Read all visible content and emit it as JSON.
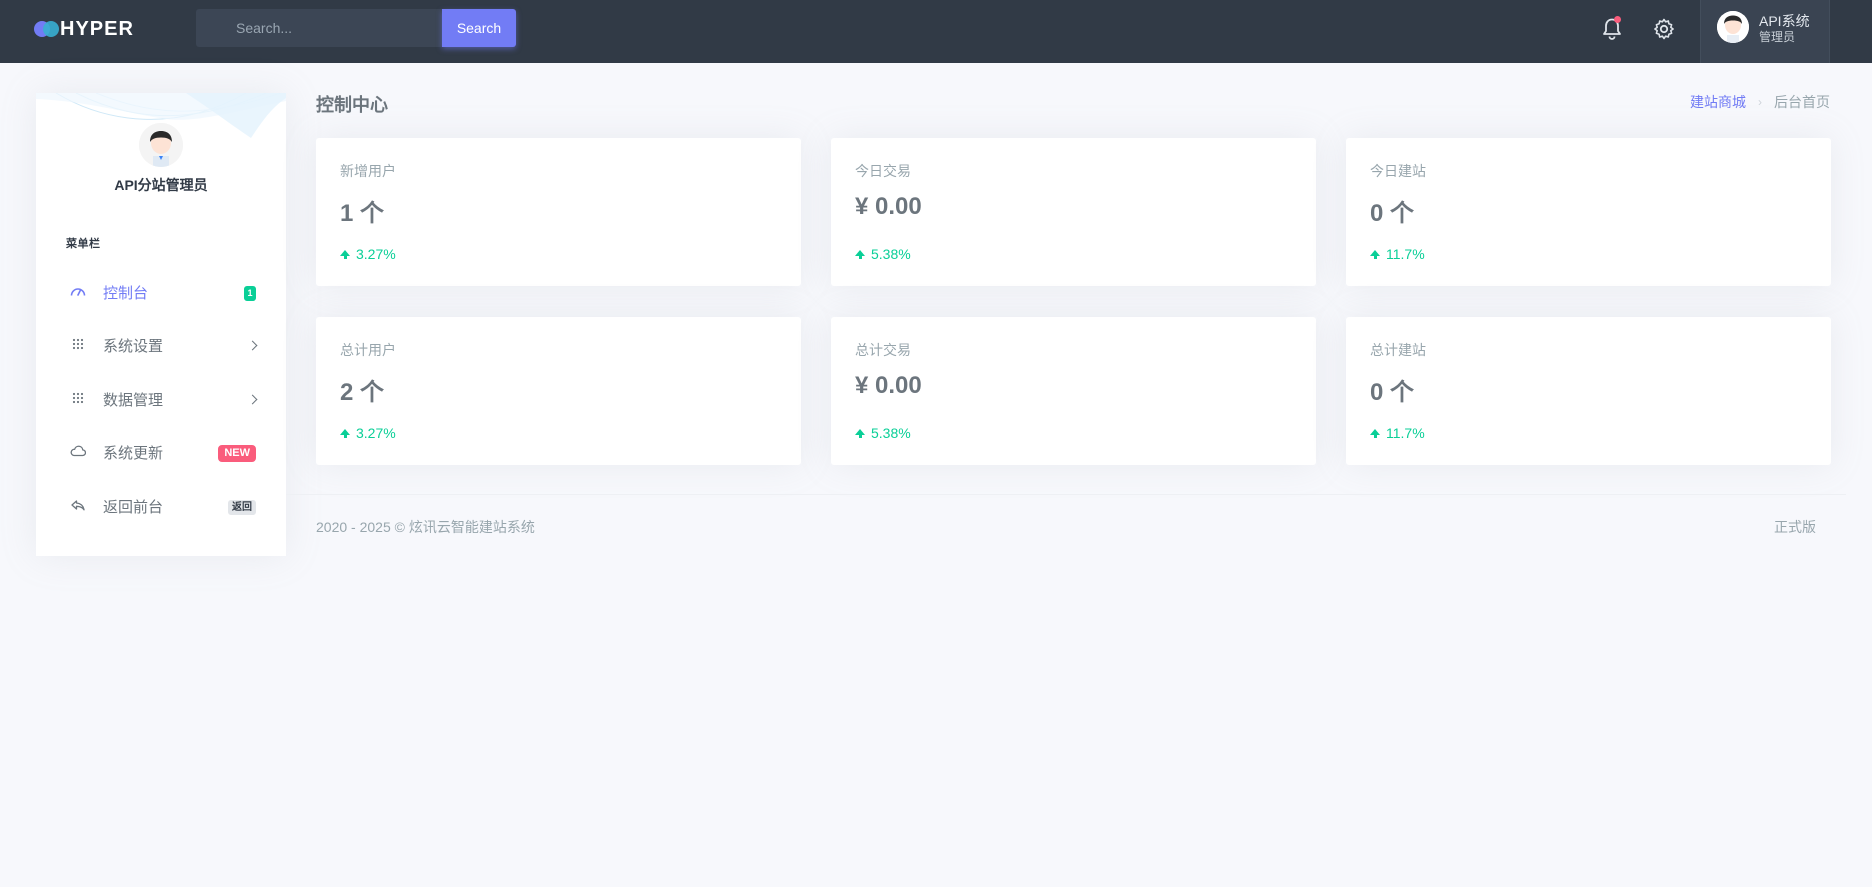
{
  "brand": {
    "name": "HYPER"
  },
  "topbar": {
    "search_placeholder": "Search...",
    "search_button": "Search",
    "user_name": "API系统",
    "user_role": "管理员"
  },
  "sidebar": {
    "profile_name": "API分站管理员",
    "menu_title": "菜单栏",
    "items": [
      {
        "label": "控制台",
        "icon": "dashboard-icon",
        "badge": "1",
        "active": true
      },
      {
        "label": "系统设置",
        "icon": "grid-icon"
      },
      {
        "label": "数据管理",
        "icon": "grid-icon"
      },
      {
        "label": "系统更新",
        "icon": "cloud-icon",
        "badge": "NEW"
      },
      {
        "label": "返回前台",
        "icon": "reply-icon",
        "badge": "返回"
      }
    ]
  },
  "header": {
    "title": "控制中心",
    "breadcrumb": [
      "建站商城",
      "后台首页"
    ]
  },
  "stats": [
    {
      "label": "新增用户",
      "value": "1 个",
      "trend": "3.27%"
    },
    {
      "label": "今日交易",
      "value": "¥ 0.00",
      "trend": "5.38%"
    },
    {
      "label": "今日建站",
      "value": "0 个",
      "trend": "11.7%"
    },
    {
      "label": "总计用户",
      "value": "2 个",
      "trend": "3.27%"
    },
    {
      "label": "总计交易",
      "value": "¥ 0.00",
      "trend": "5.38%"
    },
    {
      "label": "总计建站",
      "value": "0 个",
      "trend": "11.7%"
    }
  ],
  "footer": {
    "copyright": "2020 - 2025 © 炫讯云智能建站系统",
    "edition": "正式版"
  },
  "colors": {
    "topbar": "#313a46",
    "accent": "#727cf5",
    "success": "#0acf97",
    "danger": "#fa5c7c"
  }
}
